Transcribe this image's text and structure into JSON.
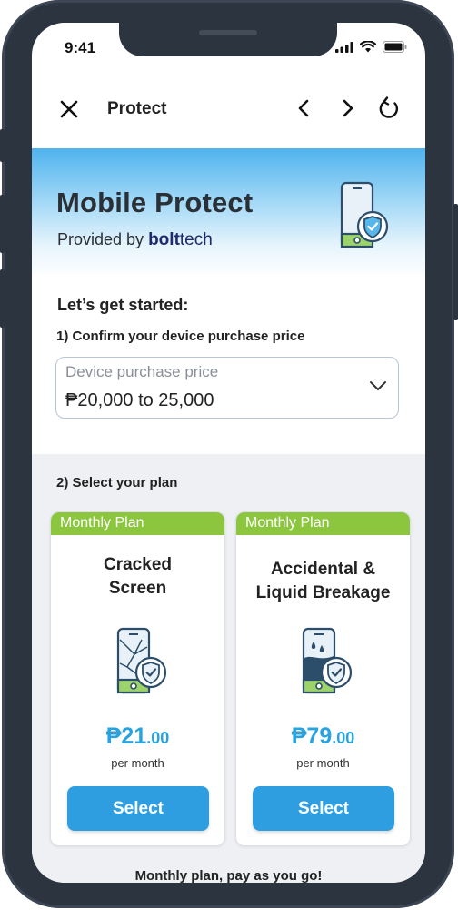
{
  "status_bar": {
    "time": "9:41"
  },
  "nav": {
    "title": "Protect"
  },
  "hero": {
    "title": "Mobile Protect",
    "provided_by": "Provided by",
    "brand_bold": "bolt",
    "brand_light": "tech"
  },
  "intro": "Let’s get started:",
  "step1": {
    "label": "1) Confirm your device purchase price",
    "placeholder": "Device purchase price",
    "value": "₱20,000 to 25,000"
  },
  "step2": {
    "label": "2) Select your plan"
  },
  "plans": [
    {
      "tag": "Monthly Plan",
      "name_line1": "Cracked",
      "name_line2": "Screen",
      "price_main": "₱21",
      "price_cents": ".00",
      "per": "per month",
      "button": "Select",
      "icon": "cracked-phone-shield-icon"
    },
    {
      "tag": "Monthly Plan",
      "name_line1": "Accidental &",
      "name_line2": "Liquid Breakage",
      "price_main": "₱79",
      "price_cents": ".00",
      "per": "per month",
      "button": "Select",
      "icon": "liquid-phone-shield-icon"
    }
  ],
  "footer": "Monthly plan, pay as you go!",
  "colors": {
    "accent_blue": "#2f9ee0",
    "price_blue": "#29a3e0",
    "tag_green": "#8cc63f",
    "frame": "#2c3440"
  }
}
